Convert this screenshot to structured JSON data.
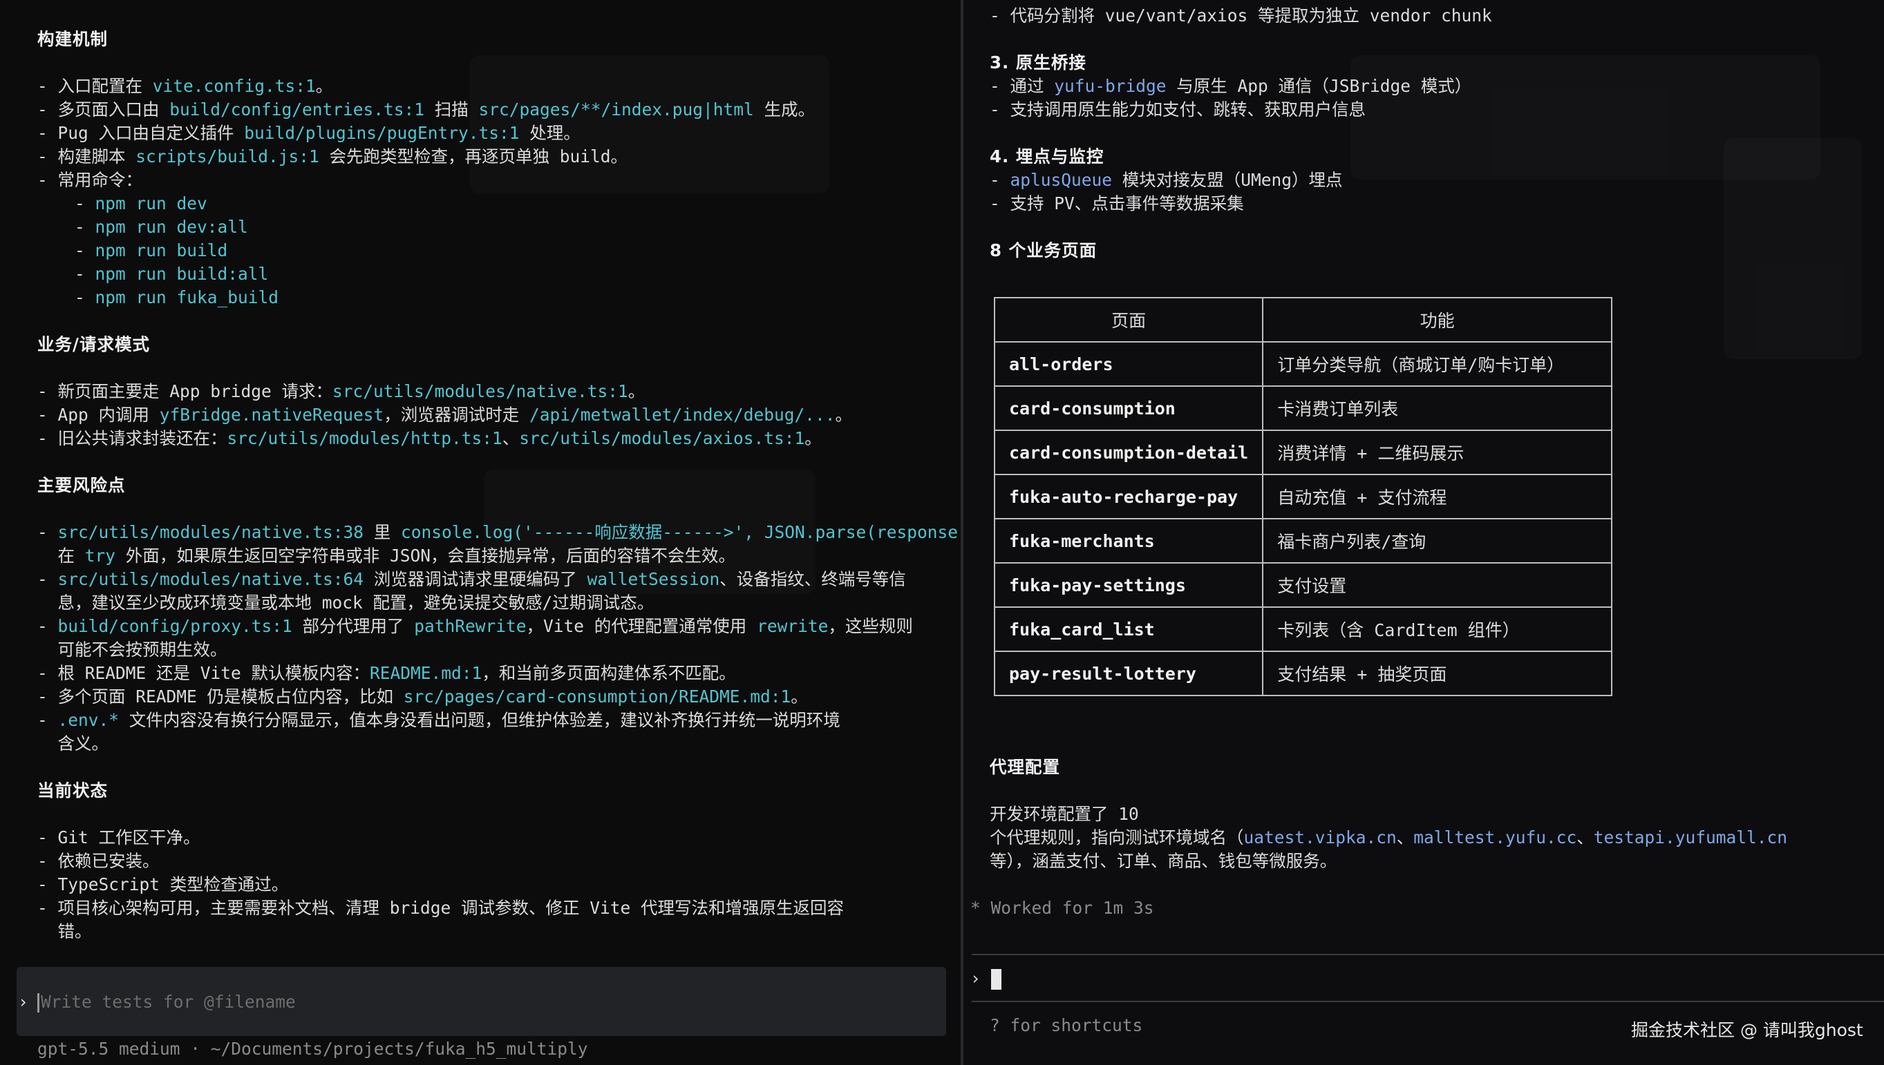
{
  "left": {
    "build_title": "构建机制",
    "build_items": [
      {
        "pre": "- 入口配置在 ",
        "code": "vite.config.ts:1",
        "post": "。"
      },
      {
        "pre": "- 多页面入口由 ",
        "code": "build/config/entries.ts:1",
        "mid": " 扫描 ",
        "code2": "src/pages/**/index.pug|html",
        "post": " 生成。"
      },
      {
        "pre": "- Pug 入口由自定义插件 ",
        "code": "build/plugins/pugEntry.ts:1",
        "post": " 处理。"
      },
      {
        "pre": "- 构建脚本 ",
        "code": "scripts/build.js:1",
        "post": " 会先跑类型检查，再逐页单独 build。"
      }
    ],
    "commands_label": "- 常用命令：",
    "commands": [
      "npm run dev",
      "npm run dev:all",
      "npm run build",
      "npm run build:all",
      "npm run fuka_build"
    ],
    "biz_title": "业务/请求模式",
    "biz_items": [
      {
        "pre": "- 新页面主要走 App bridge 请求：",
        "code": "src/utils/modules/native.ts:1",
        "post": "。"
      },
      {
        "pre": "- App 内调用 ",
        "code": "yfBridge.nativeRequest",
        "mid": "，浏览器调试时走 ",
        "code2": "/api/metwallet/index/debug/...",
        "post": "。"
      },
      {
        "pre": "- 旧公共请求封装还在：",
        "code": "src/utils/modules/http.ts:1",
        "mid": "、",
        "code2": "src/utils/modules/axios.ts:1",
        "post": "。"
      }
    ],
    "risk_title": "主要风险点",
    "risk_lines": [
      {
        "pre": "- ",
        "code": "src/utils/modules/native.ts:38",
        "mid": " 里 ",
        "code2": "console.log('------响应数据------>', JSON.parse(response))",
        "post": ""
      },
      {
        "pre": "  在 ",
        "code": "try",
        "post": " 外面，如果原生返回空字符串或非 JSON，会直接抛异常，后面的容错不会生效。"
      },
      {
        "pre": "- ",
        "code": "src/utils/modules/native.ts:64",
        "mid": " 浏览器调试请求里硬编码了 ",
        "code2": "walletSession",
        "post": "、设备指纹、终端号等信"
      },
      {
        "pre": "  息，建议至少改成环境变量或本地 mock 配置，避免误提交敏感/过期调试态。"
      },
      {
        "pre": "- ",
        "code": "build/config/proxy.ts:1",
        "mid": " 部分代理用了 ",
        "code2": "pathRewrite",
        "mid2": "，Vite 的代理配置通常使用 ",
        "code3": "rewrite",
        "post": "，这些规则"
      },
      {
        "pre": "  可能不会按预期生效。"
      },
      {
        "pre": "- 根 README 还是 Vite 默认模板内容：",
        "code": "README.md:1",
        "post": "，和当前多页面构建体系不匹配。"
      },
      {
        "pre": "- 多个页面 README 仍是模板占位内容，比如 ",
        "code": "src/pages/card-consumption/README.md:1",
        "post": "。"
      },
      {
        "pre": "- ",
        "code": ".env.*",
        "post": " 文件内容没有换行分隔显示，值本身没看出问题，但维护体验差，建议补齐换行并统一说明环境"
      },
      {
        "pre": "  含义。"
      }
    ],
    "status_title": "当前状态",
    "status_items": [
      "- Git 工作区干净。",
      "- 依赖已安装。",
      "- TypeScript 类型检查通过。",
      "- 项目核心架构可用，主要需要补文档、清理 bridge 调试参数、修正 Vite 代理写法和增强原生返回容",
      "  错。"
    ],
    "prompt_symbol": "›",
    "input_placeholder": "Write tests for @filename",
    "footer": "gpt-5.5 medium · ~/Documents/projects/fuka_h5_multiply"
  },
  "right": {
    "top_line": {
      "pre": "- 代码分割将 vue/vant/axios 等提取为独立 vendor chunk"
    },
    "s3_title": "3. 原生桥接",
    "s3_items": [
      {
        "pre": "- 通过 ",
        "code": "yufu-bridge",
        "post": " 与原生 App 通信（JSBridge 模式）"
      },
      {
        "pre": "- 支持调用原生能力如支付、跳转、获取用户信息"
      }
    ],
    "s4_title": "4. 埋点与监控",
    "s4_items": [
      {
        "pre": "- ",
        "code": "aplusQueue",
        "post": " 模块对接友盟（UMeng）埋点"
      },
      {
        "pre": "- 支持 PV、点击事件等数据采集"
      }
    ],
    "pages_title": "8 个业务页面",
    "table": {
      "headers": [
        "页面",
        "功能"
      ],
      "rows": [
        [
          "all-orders",
          "订单分类导航（商城订单/购卡订单）"
        ],
        [
          "card-consumption",
          "卡消费订单列表"
        ],
        [
          "card-consumption-detail",
          "消费详情 + 二维码展示"
        ],
        [
          "fuka-auto-recharge-pay",
          "自动充值 + 支付流程"
        ],
        [
          "fuka-merchants",
          "福卡商户列表/查询"
        ],
        [
          "fuka-pay-settings",
          "支付设置"
        ],
        [
          "fuka_card_list",
          "卡列表（含 CardItem 组件）"
        ],
        [
          "pay-result-lottery",
          "支付结果 + 抽奖页面"
        ]
      ]
    },
    "proxy_title": "代理配置",
    "proxy_line1": "开发环境配置了 10",
    "proxy_line2": {
      "pre": "个代理规则，指向测试环境域名（",
      "d1": "uatest.vipka.cn",
      "s1": "、",
      "d2": "malltest.yufu.cc",
      "s2": "、",
      "d3": "testapi.yufumall.cn"
    },
    "proxy_line3": "等），涵盖支付、订单、商品、钱包等微服务。",
    "worked": "* Worked for 1m 3s",
    "prompt_symbol": "›",
    "shortcuts": "? for shortcuts",
    "watermark": "掘金技术社区 @ 请叫我ghost"
  }
}
